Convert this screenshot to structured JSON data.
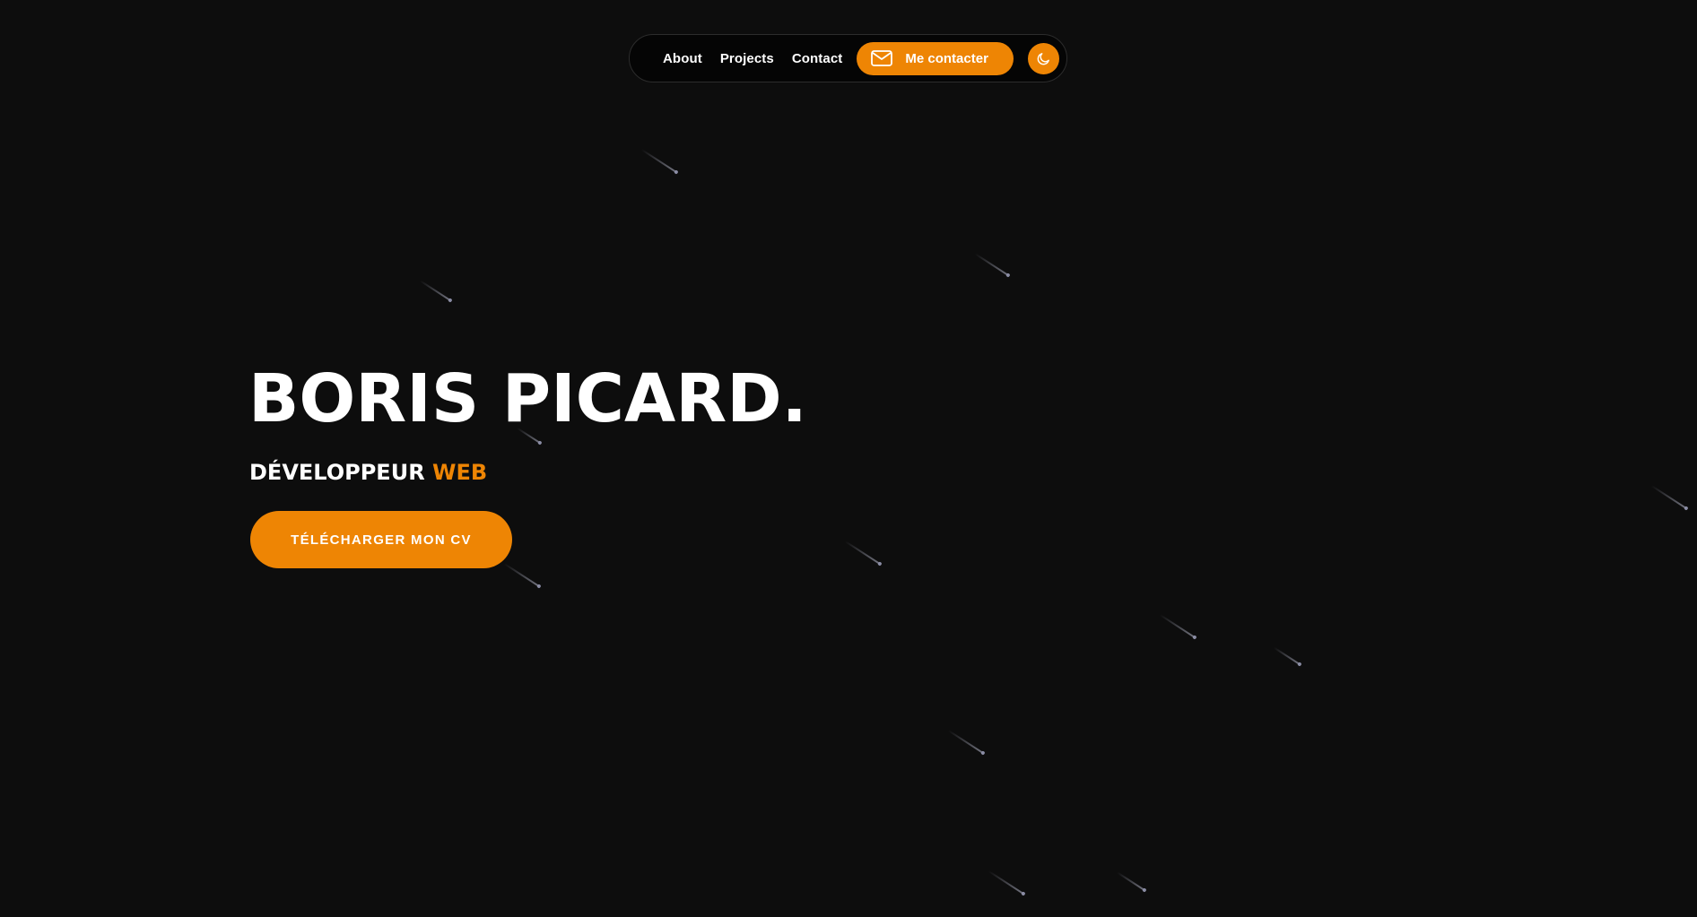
{
  "nav": {
    "links": [
      {
        "label": "About"
      },
      {
        "label": "Projects"
      },
      {
        "label": "Contact"
      }
    ],
    "contact_button_label": "Me contacter",
    "contact_button_icon": "mail-icon",
    "theme_toggle_icon": "moon-icon"
  },
  "hero": {
    "name": "BORIS PICARD.",
    "role_prefix": "DÉVELOPPEUR",
    "role_accent": "WEB",
    "cv_button_label": "TÉLÉCHARGER MON CV"
  },
  "colors": {
    "background": "#0d0d0d",
    "accent": "#ee8504",
    "text": "#ffffff",
    "meteor": "#8a8ca4"
  }
}
